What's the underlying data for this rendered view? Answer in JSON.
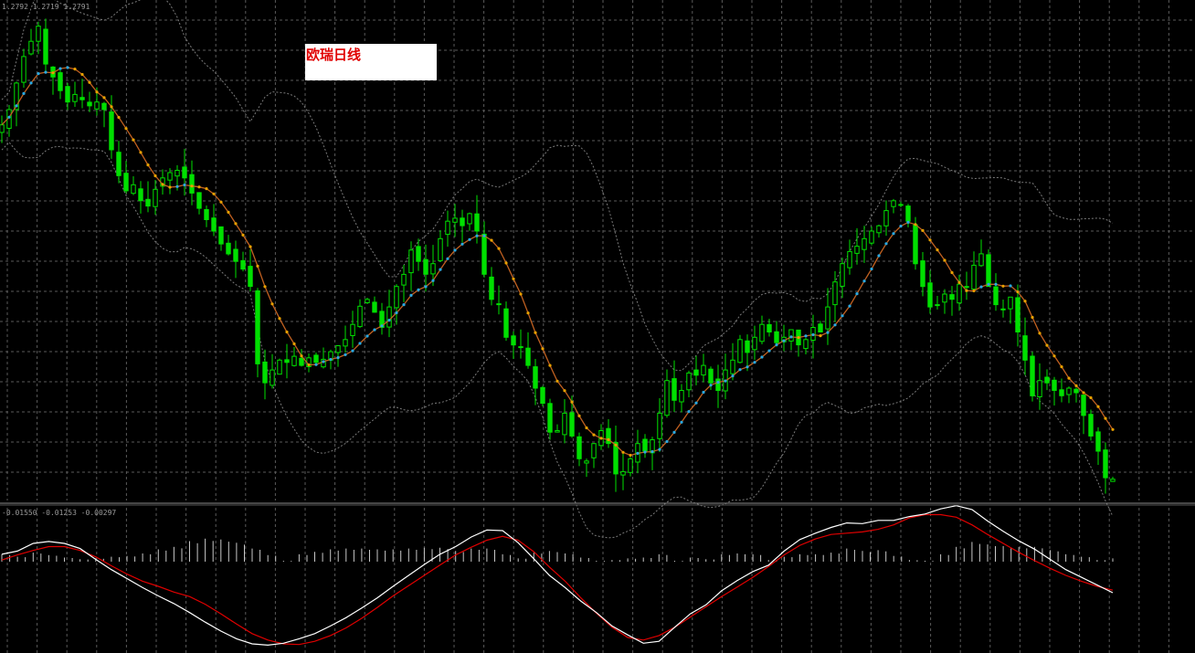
{
  "chart_data": [
    {
      "type": "candlestick",
      "title": "欧瑞日线",
      "header_values": "1.2792 1.2719 1.2791",
      "grid": true,
      "colors": {
        "background": "#000000",
        "grid": "#5a5a5a",
        "candle": "#00e000",
        "bands": "#7a7a7a",
        "ma_down": "#e8a000",
        "ma_down_line": "#c06020",
        "ma_up": "#2aa8e0",
        "ma_up_line": "#c06020"
      },
      "closes": [
        1.2635,
        1.2655,
        1.269,
        1.2725,
        1.2745,
        1.2765,
        1.2715,
        1.2698,
        1.268,
        1.2665,
        1.2675,
        1.2668,
        1.266,
        1.2665,
        1.2655,
        1.2602,
        1.2568,
        1.2548,
        1.2556,
        1.2535,
        1.2528,
        1.255,
        1.2565,
        1.2572,
        1.2575,
        1.2565,
        1.2545,
        1.2525,
        1.251,
        1.2495,
        1.2478,
        1.2465,
        1.2455,
        1.2445,
        1.2422,
        1.232,
        1.2295,
        1.2312,
        1.2325,
        1.2322,
        1.233,
        1.2318,
        1.2328,
        1.2322,
        1.2326,
        1.2336,
        1.2344,
        1.2352,
        1.2372,
        1.2396,
        1.2405,
        1.2388,
        1.2368,
        1.2395,
        1.2422,
        1.2438,
        1.247,
        1.2455,
        1.2438,
        1.2452,
        1.2485,
        1.2508,
        1.2512,
        1.2502,
        1.2518,
        1.2495,
        1.2438,
        1.2405,
        1.2398,
        1.2355,
        1.2345,
        1.2342,
        1.2318,
        1.2288,
        1.2268,
        1.223,
        1.2232,
        1.2255,
        1.2225,
        1.2195,
        1.2192,
        1.2215,
        1.2232,
        1.2215,
        1.2175,
        1.2178,
        1.2195,
        1.2215,
        1.2205,
        1.222,
        1.2255,
        1.2298,
        1.2272,
        1.2285,
        1.2308,
        1.2305,
        1.2318,
        1.2295,
        1.2285,
        1.2312,
        1.2325,
        1.2352,
        1.2335,
        1.2355,
        1.2372,
        1.2362,
        1.2348,
        1.2355,
        1.2365,
        1.2345,
        1.2352,
        1.2368,
        1.2362,
        1.2395,
        1.2428,
        1.2452,
        1.2468,
        1.2475,
        1.2485,
        1.2495,
        1.2502,
        1.2522,
        1.2535,
        1.253,
        1.2508,
        1.2452,
        1.2422,
        1.2395,
        1.2398,
        1.2412,
        1.2405,
        1.2425,
        1.2422,
        1.245,
        1.2465,
        1.2422,
        1.2398,
        1.2392,
        1.2408,
        1.2362,
        1.2325,
        1.2278,
        1.2298,
        1.2295,
        1.2285,
        1.2278,
        1.2288,
        1.2282,
        1.2252,
        1.2225,
        1.2205,
        1.217,
        1.2168
      ],
      "y_range": [
        1.214,
        1.2785
      ]
    },
    {
      "type": "macd",
      "header_values": "-0.01550 -0.01253 -0.00297",
      "colors": {
        "macd": "#ffffff",
        "signal": "#e00000",
        "histogram": "#c8c8c8"
      },
      "macd": [
        -0.0095,
        -0.009,
        -0.0078,
        -0.0075,
        -0.0078,
        -0.0086,
        -0.0103,
        -0.0119,
        -0.0133,
        -0.0147,
        -0.016,
        -0.0172,
        -0.0186,
        -0.0201,
        -0.0215,
        -0.0227,
        -0.0235,
        -0.0237,
        -0.0234,
        -0.0227,
        -0.0219,
        -0.0207,
        -0.0194,
        -0.0179,
        -0.0163,
        -0.0145,
        -0.0128,
        -0.0111,
        -0.0095,
        -0.0083,
        -0.0068,
        -0.0057,
        -0.0058,
        -0.0077,
        -0.0102,
        -0.0128,
        -0.0147,
        -0.0168,
        -0.0186,
        -0.0207,
        -0.0221,
        -0.0234,
        -0.0231,
        -0.0209,
        -0.0188,
        -0.0174,
        -0.0152,
        -0.0136,
        -0.0122,
        -0.0112,
        -0.009,
        -0.0072,
        -0.0062,
        -0.0053,
        -0.0046,
        -0.0047,
        -0.0042,
        -0.0042,
        -0.0036,
        -0.0032,
        -0.0024,
        -0.0019,
        -0.0025,
        -0.0043,
        -0.0059,
        -0.0074,
        -0.0087,
        -0.0103,
        -0.0119,
        -0.0131,
        -0.0143,
        -0.0155
      ],
      "signal": [
        -0.0104,
        -0.0096,
        -0.0089,
        -0.0083,
        -0.0083,
        -0.0089,
        -0.0099,
        -0.0113,
        -0.0126,
        -0.0137,
        -0.0145,
        -0.0154,
        -0.0161,
        -0.0173,
        -0.0188,
        -0.0204,
        -0.0219,
        -0.0229,
        -0.0235,
        -0.0236,
        -0.0231,
        -0.0222,
        -0.021,
        -0.0195,
        -0.0178,
        -0.016,
        -0.0144,
        -0.0128,
        -0.0112,
        -0.0096,
        -0.0084,
        -0.0073,
        -0.0067,
        -0.0073,
        -0.0091,
        -0.0115,
        -0.0137,
        -0.0163,
        -0.0187,
        -0.0209,
        -0.0225,
        -0.0229,
        -0.0222,
        -0.0209,
        -0.0193,
        -0.0177,
        -0.0161,
        -0.0146,
        -0.0131,
        -0.0114,
        -0.0096,
        -0.0081,
        -0.0071,
        -0.0064,
        -0.0062,
        -0.006,
        -0.0056,
        -0.0049,
        -0.0038,
        -0.0033,
        -0.0033,
        -0.0037,
        -0.0049,
        -0.0064,
        -0.0078,
        -0.0092,
        -0.0105,
        -0.0117,
        -0.0128,
        -0.0137,
        -0.0145,
        -0.0151
      ],
      "y_range": [
        -0.0245,
        -0.0028
      ]
    }
  ]
}
